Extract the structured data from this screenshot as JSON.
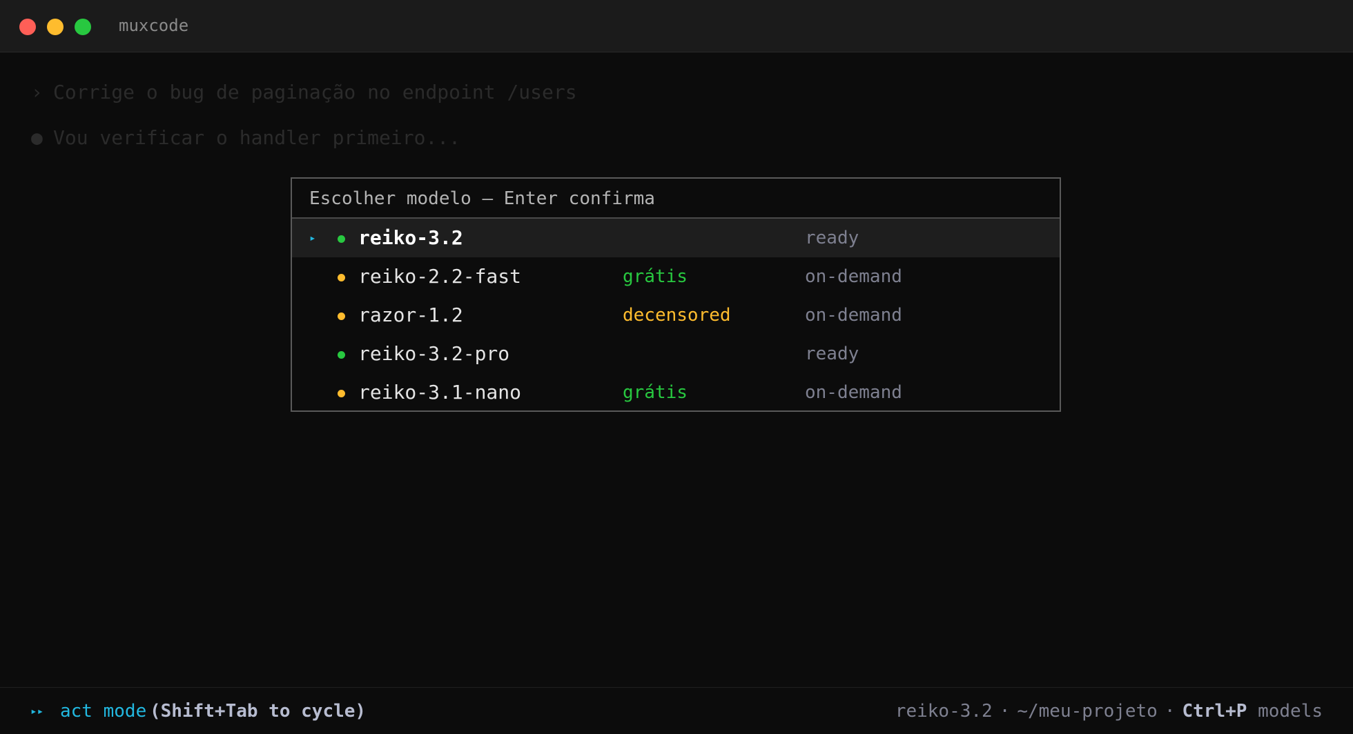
{
  "window": {
    "title": "muxcode"
  },
  "conversation": {
    "user_marker": "›",
    "user_message": "Corrige o bug de paginação no endpoint /users",
    "assistant_marker": "●",
    "assistant_message": "Vou verificar o handler primeiro..."
  },
  "model_picker": {
    "header": "Escolher modelo — Enter confirma",
    "cursor_glyph": "▸",
    "selected_index": 0,
    "models": [
      {
        "name": "reiko-3.2",
        "tag": "",
        "tag_color": "",
        "status": "ready",
        "dot_color": "#28c840"
      },
      {
        "name": "reiko-2.2-fast",
        "tag": "grátis",
        "tag_color": "#28c840",
        "status": "on-demand",
        "dot_color": "#febc2e"
      },
      {
        "name": "razor-1.2",
        "tag": "decensored",
        "tag_color": "#febc2e",
        "status": "on-demand",
        "dot_color": "#febc2e"
      },
      {
        "name": "reiko-3.2-pro",
        "tag": "",
        "tag_color": "",
        "status": "ready",
        "dot_color": "#28c840"
      },
      {
        "name": "reiko-3.1-nano",
        "tag": "grátis",
        "tag_color": "#28c840",
        "status": "on-demand",
        "dot_color": "#febc2e"
      }
    ]
  },
  "statusbar": {
    "mode_arrows": "▸▸",
    "mode_label": "act mode",
    "mode_hint": "(Shift+Tab to cycle)",
    "current_model": "reiko-3.2",
    "separator": "·",
    "project_path": "~/meu-projeto",
    "shortcut_key": "Ctrl+P",
    "shortcut_label": "models"
  },
  "colors": {
    "accent": "#22b8e0",
    "ready": "#28c840",
    "on_demand": "#febc2e",
    "muted": "#7e8090"
  }
}
